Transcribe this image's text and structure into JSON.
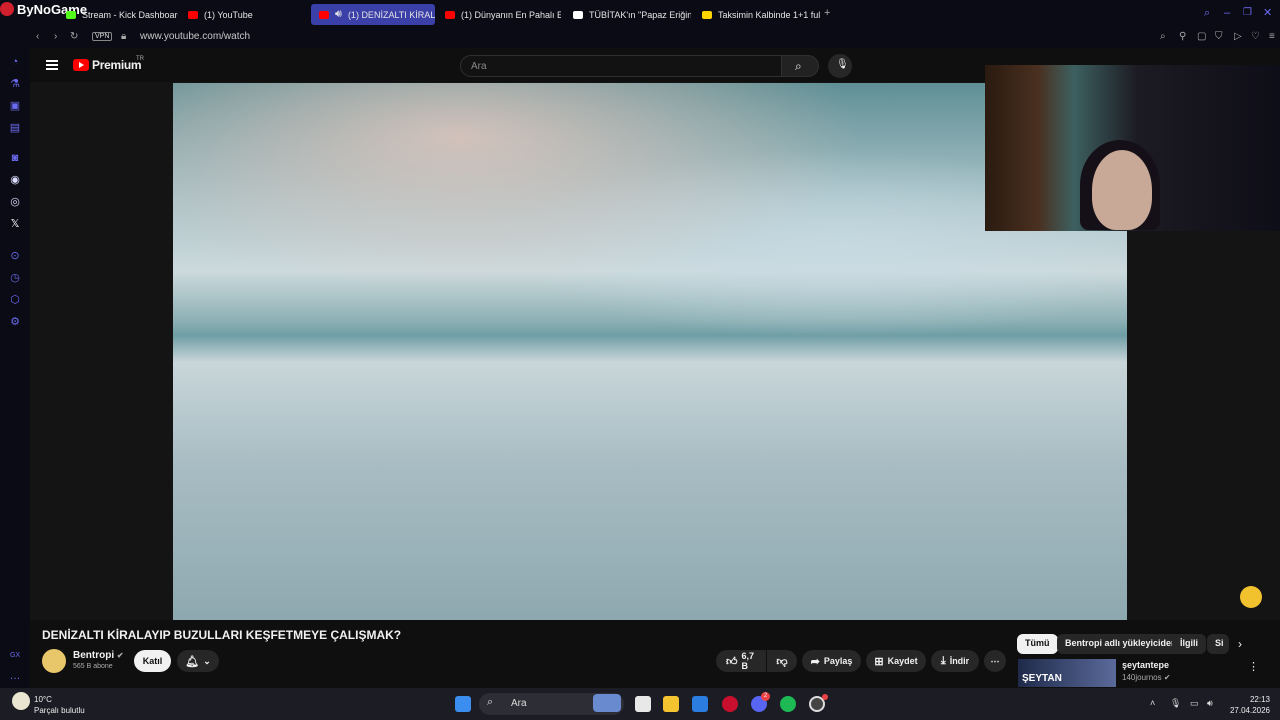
{
  "browser": {
    "brand": "ByNoGame",
    "tabs": [
      {
        "label": "Stream - Kick Dashboard",
        "active": false
      },
      {
        "label": "(1) YouTube",
        "active": false
      },
      {
        "label": "(1) DENİZALTI KİRALA",
        "active": true
      },
      {
        "label": "(1) Dünyanın En Pahalı Evi",
        "active": false
      },
      {
        "label": "TÜBİTAK'ın \"Papaz Eriğini",
        "active": false
      },
      {
        "label": "Taksimin Kalbinde 1+1 full",
        "active": false
      }
    ],
    "vpn_label": "VPN",
    "url": "www.youtube.com/watch"
  },
  "youtube": {
    "logo_text": "Premium",
    "region": "TR",
    "search_placeholder": "Ara",
    "notifications_count": "1"
  },
  "video": {
    "title": "DENİZALTI KİRALAYIP BUZULLARI KEŞFETMEYE ÇALIŞMAK?",
    "channel": "Bentropi",
    "subscribers": "565 B abone",
    "join_label": "Katıl",
    "likes": "6,7 B",
    "share_label": "Paylaş",
    "save_label": "Kaydet",
    "download_label": "İndir"
  },
  "recommendations": {
    "chips": [
      "Tümü",
      "Bentropi adlı yükleyiciden",
      "İlgili",
      "Si"
    ],
    "first": {
      "title": "şeytantepe",
      "channel": "140journos",
      "thumb_text": "ŞEYTAN"
    }
  },
  "taskbar": {
    "temperature": "10°C",
    "weather": "Parçalı bulutlu",
    "search_label": "Ara",
    "time": "22:13",
    "date": "27.04.2026",
    "discord_badge": "2"
  },
  "sidebar_bottom": "GX"
}
